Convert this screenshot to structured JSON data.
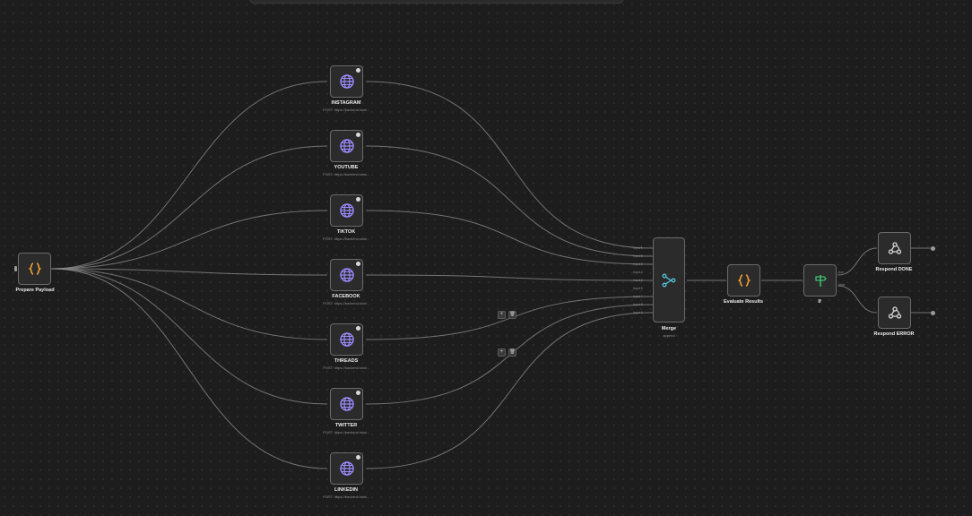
{
  "colors": {
    "canvas_bg": "#1d1d1d",
    "node_bg": "#2b2b2b",
    "node_border": "#6a6a6a",
    "code_icon": "#f0a030",
    "http_icon": "#9a8cff",
    "merge_icon": "#4fc3d9",
    "if_icon": "#3fbf6f",
    "webhook_icon": "#dcdcdc"
  },
  "nodes": {
    "prepare": {
      "label": "Prepare Payload",
      "icon": "code-braces-icon"
    },
    "instagram": {
      "label": "INSTAGRAM",
      "sub": "POST: https://backend.total...",
      "icon": "globe-icon"
    },
    "youtube": {
      "label": "YOUTUBE",
      "sub": "POST: https://backend.total...",
      "icon": "globe-icon"
    },
    "tiktok": {
      "label": "TIKTOK",
      "sub": "POST: https://backend.total...",
      "icon": "globe-icon"
    },
    "facebook": {
      "label": "FACEBOOK",
      "sub": "POST: https://backend.total...",
      "icon": "globe-icon"
    },
    "threads": {
      "label": "THREADS",
      "sub": "POST: https://backend.total...",
      "icon": "globe-icon"
    },
    "twitter": {
      "label": "TWITTER",
      "sub": "POST: https://backend.total...",
      "icon": "globe-icon"
    },
    "linkedin": {
      "label": "LINKEDIN",
      "sub": "POST: https://backend.total...",
      "icon": "globe-icon"
    },
    "merge": {
      "label": "Merge",
      "sub": "append",
      "icon": "merge-icon",
      "inputs": [
        "Input 1",
        "Input 2",
        "Input 3",
        "Input 4",
        "Input 5",
        "Input 6",
        "Input 7",
        "Input 8",
        "Input 9"
      ]
    },
    "evaluate": {
      "label": "Evaluate Results",
      "icon": "code-braces-icon"
    },
    "if": {
      "label": "If",
      "true_label": "true",
      "false_label": "false",
      "icon": "signpost-icon"
    },
    "respond_done": {
      "label": "Respond DONE",
      "icon": "webhook-icon"
    },
    "respond_error": {
      "label": "Respond ERROR",
      "icon": "webhook-icon"
    }
  },
  "edge_buttons": {
    "add": "+",
    "delete": "🗑"
  }
}
